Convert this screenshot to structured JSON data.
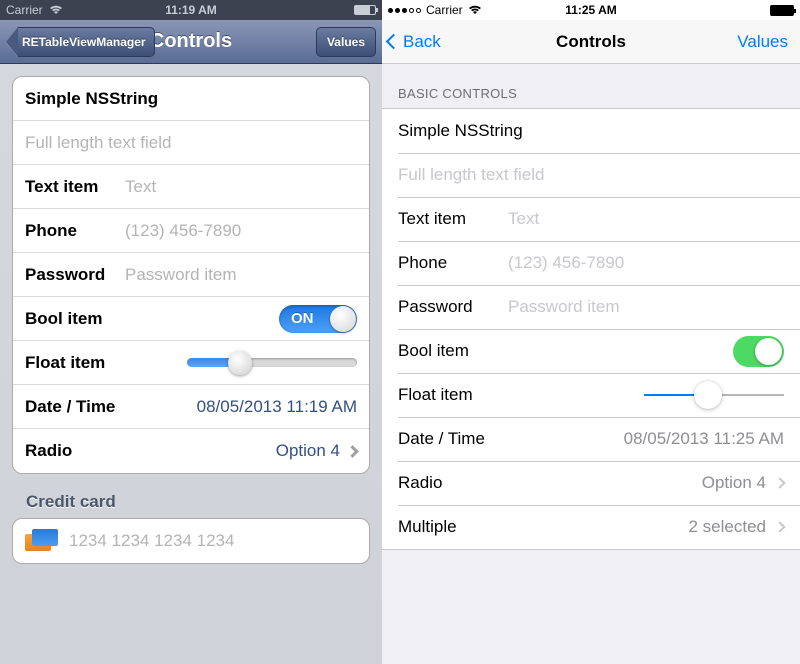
{
  "ios6": {
    "status": {
      "carrier": "Carrier",
      "time": "11:19 AM"
    },
    "nav": {
      "back": "RETableViewManager",
      "title": "Controls",
      "right": "Values"
    },
    "cells": {
      "simple": "Simple NSString",
      "full_placeholder": "Full length text field",
      "text_label": "Text item",
      "text_placeholder": "Text",
      "phone_label": "Phone",
      "phone_placeholder": "(123) 456-7890",
      "password_label": "Password",
      "password_placeholder": "Password item",
      "bool_label": "Bool item",
      "bool_on": "ON",
      "float_label": "Float item",
      "datetime_label": "Date / Time",
      "datetime_value": "08/05/2013 11:19 AM",
      "radio_label": "Radio",
      "radio_value": "Option 4"
    },
    "cc_header": "Credit card",
    "cc_placeholder": "1234 1234 1234 1234"
  },
  "ios7": {
    "status": {
      "carrier": "Carrier",
      "time": "11:25 AM"
    },
    "nav": {
      "back": "Back",
      "title": "Controls",
      "right": "Values"
    },
    "section_header": "BASIC CONTROLS",
    "cells": {
      "simple": "Simple NSString",
      "full_placeholder": "Full length text field",
      "text_label": "Text item",
      "text_placeholder": "Text",
      "phone_label": "Phone",
      "phone_placeholder": "(123) 456-7890",
      "password_label": "Password",
      "password_placeholder": "Password item",
      "bool_label": "Bool item",
      "float_label": "Float item",
      "datetime_label": "Date / Time",
      "datetime_value": "08/05/2013 11:25 AM",
      "radio_label": "Radio",
      "radio_value": "Option 4",
      "multiple_label": "Multiple",
      "multiple_value": "2 selected"
    }
  }
}
